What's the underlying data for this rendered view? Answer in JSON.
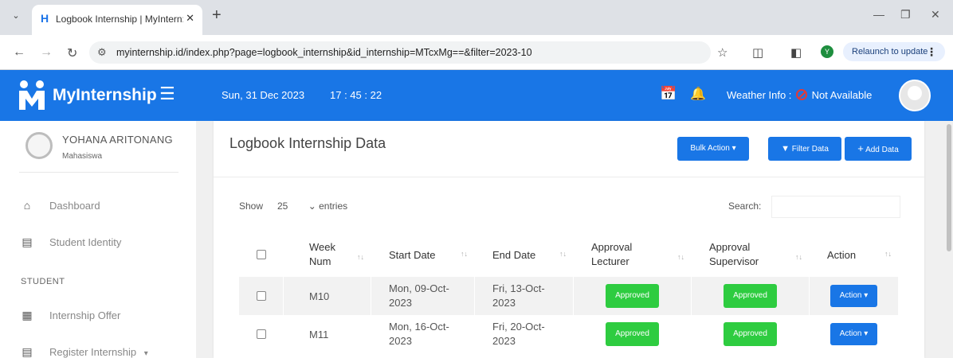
{
  "browser": {
    "tab_title": "Logbook Internship | MyIntern:",
    "tab_favicon": "H",
    "url": "myinternship.id/index.php?page=logbook_internship&id_internship=MTcxMg==&filter=2023-10",
    "profile_initial": "Y",
    "relaunch_label": "Relaunch to update"
  },
  "header": {
    "brand": "MyInternship",
    "date": "Sun, 31 Dec 2023",
    "time": "17 : 45 : 22",
    "weather_label": "Weather Info :",
    "weather_value": "Not Available"
  },
  "sidebar": {
    "user_name": "YOHANA ARITONANG",
    "user_role": "Mahasiswa",
    "items": [
      {
        "label": "Dashboard",
        "icon": "home-icon"
      },
      {
        "label": "Student Identity",
        "icon": "id-card-icon"
      }
    ],
    "section_label": "STUDENT",
    "student_items": [
      {
        "label": "Internship Offer",
        "icon": "clipboard-icon"
      },
      {
        "label": "Register Internship",
        "icon": "form-icon"
      }
    ]
  },
  "main": {
    "title": "Logbook Internship Data",
    "bulk_action_label": "Bulk Action",
    "filter_label": "Filter Data",
    "add_label": "Add Data",
    "show_label": "Show",
    "entries_value": "25",
    "entries_label": "entries",
    "search_label": "Search:",
    "search_value": ""
  },
  "table": {
    "columns": [
      "Week Num",
      "Start Date",
      "End Date",
      "Approval Lecturer",
      "Approval Supervisor",
      "Action"
    ],
    "rows": [
      {
        "week": "M10",
        "start": "Mon, 09-Oct-2023",
        "end": "Fri, 13-Oct-2023",
        "lecturer": "Approved",
        "supervisor": "Approved",
        "action": "Action"
      },
      {
        "week": "M11",
        "start": "Mon, 16-Oct-2023",
        "end": "Fri, 20-Oct-2023",
        "lecturer": "Approved",
        "supervisor": "Approved",
        "action": "Action"
      }
    ]
  },
  "colors": {
    "primary": "#1976e6",
    "approved": "#2ecc40",
    "weather_na": "#e53935"
  }
}
